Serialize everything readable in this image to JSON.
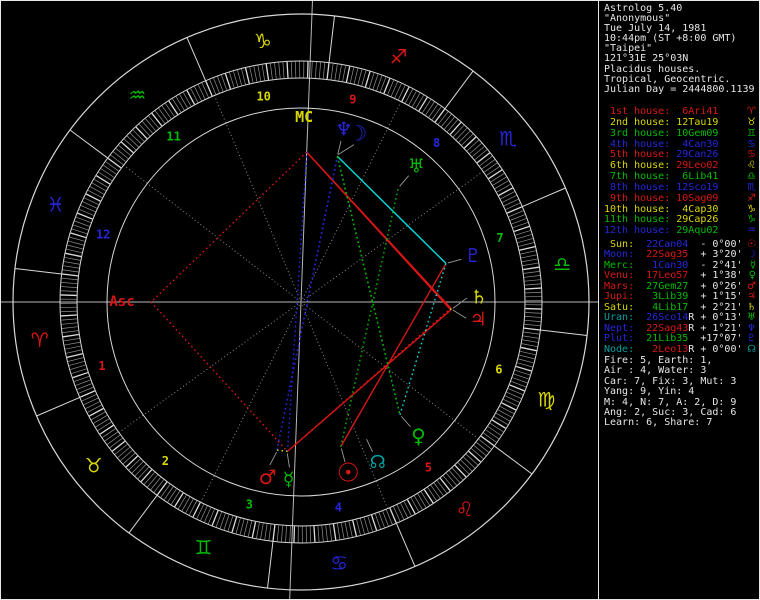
{
  "colors": {
    "red": "#d81616",
    "yellow": "#d8d800",
    "green": "#00bb00",
    "blue": "#2626dd",
    "teal": "#00a0a0",
    "cyan": "#00dddd",
    "white": "#e6e6e6",
    "gray": "#8a8a8a",
    "axis": "#b8b8b8",
    "ring": "#d8d8d8"
  },
  "sidebar": {
    "header_lines": [
      "Astrolog 5.40",
      "\"Anonymous\"",
      "Tue July 14, 1981",
      "10:44pm (ST +8:00 GMT)",
      "\"Taipei\"",
      "121°31E 25°03N",
      "Placidus houses.",
      "Tropical, Geocentric.",
      "Julian Day = 2444800.1139"
    ],
    "house_rows": [
      {
        "label": " 1st house:",
        "color": "red",
        "value": "6Ari41",
        "value_color": "red",
        "glyph": "♈",
        "glyph_color": "red"
      },
      {
        "label": " 2nd house:",
        "color": "yellow",
        "value": "12Tau19",
        "value_color": "yellow",
        "glyph": "♉",
        "glyph_color": "yellow"
      },
      {
        "label": " 3rd house:",
        "color": "green",
        "value": "10Gem09",
        "value_color": "green",
        "glyph": "♊",
        "glyph_color": "green"
      },
      {
        "label": " 4th house:",
        "color": "blue",
        "value": "4Can30",
        "value_color": "blue",
        "glyph": "♋",
        "glyph_color": "blue"
      },
      {
        "label": " 5th house:",
        "color": "red",
        "value": "29Can26",
        "value_color": "blue",
        "glyph": "♋",
        "glyph_color": "red"
      },
      {
        "label": " 6th house:",
        "color": "yellow",
        "value": "29Leo02",
        "value_color": "red",
        "glyph": "♌",
        "glyph_color": "yellow"
      },
      {
        "label": " 7th house:",
        "color": "green",
        "value": "6Lib41",
        "value_color": "green",
        "glyph": "♎",
        "glyph_color": "green"
      },
      {
        "label": " 8th house:",
        "color": "blue",
        "value": "12Sco19",
        "value_color": "blue",
        "glyph": "♏",
        "glyph_color": "blue"
      },
      {
        "label": " 9th house:",
        "color": "red",
        "value": "10Sag09",
        "value_color": "red",
        "glyph": "♐",
        "glyph_color": "red"
      },
      {
        "label": "10th house:",
        "color": "yellow",
        "value": "4Cap30",
        "value_color": "yellow",
        "glyph": "♑",
        "glyph_color": "yellow"
      },
      {
        "label": "11th house:",
        "color": "green",
        "value": "29Cap26",
        "value_color": "yellow",
        "glyph": "♑",
        "glyph_color": "green"
      },
      {
        "label": "12th house:",
        "color": "blue",
        "value": "29Aqu02",
        "value_color": "green",
        "glyph": "♒",
        "glyph_color": "blue"
      }
    ],
    "planet_rows": [
      {
        "label": "Sun:",
        "label_color": "yellow",
        "value": "22Can04",
        "value_color": "blue",
        "retro": " ",
        "delta": "- 0°00'",
        "glyph": "☉",
        "glyph_color": "red"
      },
      {
        "label": "Moon:",
        "label_color": "blue",
        "value": "22Sag35",
        "value_color": "red",
        "retro": " ",
        "delta": "+ 3°20'",
        "glyph": "☽",
        "glyph_color": "blue"
      },
      {
        "label": "Merc:",
        "label_color": "green",
        "value": "1Can30",
        "value_color": "blue",
        "retro": " ",
        "delta": "- 2°41'",
        "glyph": "☿",
        "glyph_color": "green"
      },
      {
        "label": "Venu:",
        "label_color": "red",
        "value": "17Leo57",
        "value_color": "red",
        "retro": " ",
        "delta": "+ 1°38'",
        "glyph": "♀",
        "glyph_color": "green"
      },
      {
        "label": "Mars:",
        "label_color": "red",
        "value": "27Gem27",
        "value_color": "green",
        "retro": " ",
        "delta": "+ 0°26'",
        "glyph": "♂",
        "glyph_color": "red"
      },
      {
        "label": "Jupi:",
        "label_color": "red",
        "value": "3Lib39",
        "value_color": "green",
        "retro": " ",
        "delta": "+ 1°15'",
        "glyph": "♃",
        "glyph_color": "red"
      },
      {
        "label": "Satu:",
        "label_color": "yellow",
        "value": "4Lib17",
        "value_color": "green",
        "retro": " ",
        "delta": "+ 2°21'",
        "glyph": "♄",
        "glyph_color": "yellow"
      },
      {
        "label": "Uran:",
        "label_color": "teal",
        "value": "26Sco14",
        "value_color": "blue",
        "retro": "R",
        "delta": "+ 0°13'",
        "glyph": "♅",
        "glyph_color": "green"
      },
      {
        "label": "Nept:",
        "label_color": "blue",
        "value": "22Sag43",
        "value_color": "red",
        "retro": "R",
        "delta": "+ 1°21'",
        "glyph": "♆",
        "glyph_color": "blue"
      },
      {
        "label": "Plut:",
        "label_color": "blue",
        "value": "21Lib35",
        "value_color": "green",
        "retro": " ",
        "delta": "+17°07'",
        "glyph": "♇",
        "glyph_color": "blue"
      },
      {
        "label": "Node:",
        "label_color": "teal",
        "value": "2Leo13",
        "value_color": "red",
        "retro": "R",
        "delta": "+ 0°00'",
        "glyph": "☊",
        "glyph_color": "teal"
      }
    ],
    "stats_lines": [
      "Fire: 5, Earth: 1,",
      "Air : 4, Water: 3",
      "Car: 7, Fix: 3, Mut: 3",
      "Yang: 9, Yin: 4",
      "M: 4, N: 7, A: 2, D: 9",
      "Ang: 2, Suc: 3, Cad: 6",
      "Learn: 6, Share: 7"
    ]
  },
  "wheel": {
    "asc_lon": 6.68,
    "mc_lon": 274.5,
    "labels": {
      "mc": "MC",
      "asc": "Asc"
    },
    "signs": [
      {
        "name": "aries",
        "glyph": "♈",
        "color": "red",
        "start": 0
      },
      {
        "name": "taurus",
        "glyph": "♉",
        "color": "yellow",
        "start": 30
      },
      {
        "name": "gemini",
        "glyph": "♊",
        "color": "green",
        "start": 60
      },
      {
        "name": "cancer",
        "glyph": "♋",
        "color": "blue",
        "start": 90
      },
      {
        "name": "leo",
        "glyph": "♌",
        "color": "red",
        "start": 120
      },
      {
        "name": "virgo",
        "glyph": "♍",
        "color": "yellow",
        "start": 150
      },
      {
        "name": "libra",
        "glyph": "♎",
        "color": "green",
        "start": 180
      },
      {
        "name": "scorpio",
        "glyph": "♏",
        "color": "blue",
        "start": 210
      },
      {
        "name": "sagittarius",
        "glyph": "♐",
        "color": "red",
        "start": 240
      },
      {
        "name": "capricorn",
        "glyph": "♑",
        "color": "yellow",
        "start": 270
      },
      {
        "name": "aquarius",
        "glyph": "♒",
        "color": "green",
        "start": 300
      },
      {
        "name": "pisces",
        "glyph": "♓",
        "color": "blue",
        "start": 330
      }
    ],
    "houses": [
      {
        "num": 1,
        "color": "red",
        "cusp_lon": 6.68
      },
      {
        "num": 2,
        "color": "yellow",
        "cusp_lon": 42.32
      },
      {
        "num": 3,
        "color": "green",
        "cusp_lon": 70.15
      },
      {
        "num": 4,
        "color": "blue",
        "cusp_lon": 94.5
      },
      {
        "num": 5,
        "color": "red",
        "cusp_lon": 119.43
      },
      {
        "num": 6,
        "color": "yellow",
        "cusp_lon": 149.03
      },
      {
        "num": 7,
        "color": "green",
        "cusp_lon": 186.68
      },
      {
        "num": 8,
        "color": "blue",
        "cusp_lon": 222.32
      },
      {
        "num": 9,
        "color": "red",
        "cusp_lon": 250.15
      },
      {
        "num": 10,
        "color": "yellow",
        "cusp_lon": 274.5
      },
      {
        "num": 11,
        "color": "green",
        "cusp_lon": 299.43
      },
      {
        "num": 12,
        "color": "blue",
        "cusp_lon": 329.03
      }
    ],
    "planets": [
      {
        "id": "sun",
        "name": "sun",
        "glyph": "☉",
        "color": "red",
        "lon": 112.07,
        "disp": 0,
        "size": 26
      },
      {
        "id": "moon",
        "name": "moon",
        "glyph": "☽",
        "color": "blue",
        "lon": 262.58,
        "disp": -4.5,
        "size": 21
      },
      {
        "id": "mer",
        "name": "mercury",
        "glyph": "☿",
        "color": "green",
        "lon": 91.5,
        "disp": 1.2,
        "size": 19
      },
      {
        "id": "ven",
        "name": "venus",
        "glyph": "♀",
        "color": "green",
        "lon": 137.95,
        "disp": 0,
        "size": 20
      },
      {
        "id": "mar",
        "name": "mars",
        "glyph": "♂",
        "color": "red",
        "lon": 87.45,
        "disp": -1.6,
        "size": 20
      },
      {
        "id": "jup",
        "name": "jupiter",
        "glyph": "♃",
        "color": "red",
        "lon": 183.65,
        "disp": -2.6,
        "size": 19
      },
      {
        "id": "sat",
        "name": "saturn",
        "glyph": "♄",
        "color": "yellow",
        "lon": 184.28,
        "disp": 3.8,
        "size": 19
      },
      {
        "id": "ura",
        "name": "uranus",
        "glyph": "♅",
        "color": "green",
        "lon": 236.23,
        "disp": 0,
        "size": 19
      },
      {
        "id": "nep",
        "name": "neptune",
        "glyph": "♆",
        "color": "blue",
        "lon": 262.72,
        "disp": 0,
        "size": 19
      },
      {
        "id": "plu",
        "name": "pluto",
        "glyph": "♇",
        "color": "blue",
        "lon": 201.58,
        "disp": 0,
        "size": 19
      },
      {
        "id": "node",
        "name": "node",
        "glyph": "☊",
        "color": "teal",
        "lon": 122.22,
        "disp": 0,
        "size": 18
      }
    ],
    "aspects": [
      {
        "a": "mc",
        "b": "sat",
        "color": "red",
        "style": "solid"
      },
      {
        "a": "mc",
        "b": "jup",
        "color": "red",
        "style": "solid"
      },
      {
        "a": "mer",
        "b": "jup",
        "color": "red",
        "style": "solid"
      },
      {
        "a": "sun",
        "b": "plu",
        "color": "red",
        "style": "solid"
      },
      {
        "a": "mer",
        "b": "sat",
        "color": "red",
        "style": "dot"
      },
      {
        "a": "mc",
        "b": "asc",
        "color": "red",
        "style": "dot"
      },
      {
        "a": "asc",
        "b": "mer",
        "color": "red",
        "style": "dot"
      },
      {
        "a": "mer",
        "b": "mc",
        "color": "blue",
        "style": "dot"
      },
      {
        "a": "mar",
        "b": "nep",
        "color": "blue",
        "style": "dot"
      },
      {
        "a": "mar",
        "b": "moon",
        "color": "blue",
        "style": "dot"
      },
      {
        "a": "moon",
        "b": "plu",
        "color": "cyan",
        "style": "solid"
      },
      {
        "a": "ven",
        "b": "plu",
        "color": "cyan",
        "style": "dot"
      },
      {
        "a": "moon",
        "b": "ven",
        "color": "green",
        "style": "dot"
      },
      {
        "a": "nep",
        "b": "ven",
        "color": "green",
        "style": "dot"
      },
      {
        "a": "sun",
        "b": "ura",
        "color": "green",
        "style": "dot"
      },
      {
        "a": "mar",
        "b": "mer",
        "color": "yellow",
        "style": "dot"
      },
      {
        "a": "moon",
        "b": "nep",
        "color": "yellow",
        "style": "dot"
      },
      {
        "a": "jup",
        "b": "sat",
        "color": "yellow",
        "style": "dot"
      }
    ]
  }
}
